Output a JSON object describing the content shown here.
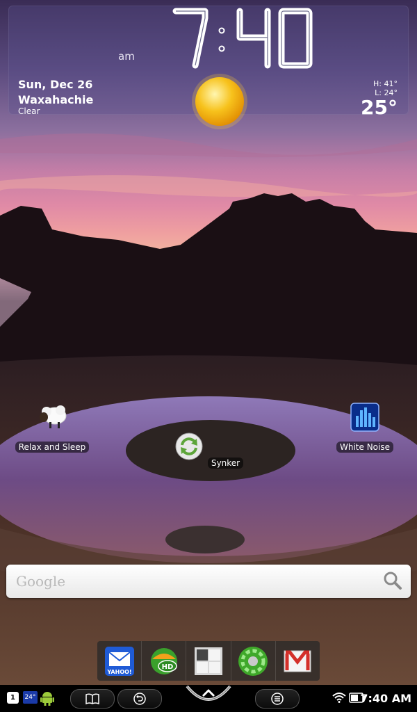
{
  "widget": {
    "clock_time": "7:40",
    "ampm": "am",
    "date": "Sun, Dec 26",
    "city": "Waxahachie",
    "condition": "Clear",
    "high": "H: 41°",
    "low": "L: 24°",
    "current_temp": "25°",
    "icon": "sun-icon"
  },
  "apps": [
    {
      "label": "Relax and Sleep",
      "icon": "sheep-icon"
    },
    {
      "label": "Synker",
      "icon": "sync-icon"
    },
    {
      "label": "White Noise",
      "icon": "equalizer-icon"
    }
  ],
  "search": {
    "placeholder": "Google",
    "icon": "search-icon"
  },
  "dock": [
    {
      "icon": "yahoo-mail-icon",
      "text": "YAHOO!"
    },
    {
      "icon": "weather-hd-icon",
      "text": "HD"
    },
    {
      "icon": "app-drawer-icon"
    },
    {
      "icon": "green-orb-icon"
    },
    {
      "icon": "gmail-icon"
    }
  ],
  "status_bar": {
    "notification_count": "1",
    "weather_badge": "24°",
    "time": "7:40 AM",
    "icons": [
      "android-icon",
      "book-icon",
      "back-icon",
      "home-icon",
      "menu-icon",
      "wifi-icon",
      "battery-icon"
    ]
  },
  "colors": {
    "widget_bg": "#5a508c",
    "search_bg": "#ffffff",
    "status_bar_bg": "#000000",
    "sun_yellow": "#f7c21c",
    "gmail_red": "#d4302a",
    "yahoo_blue": "#1f5bd6"
  }
}
